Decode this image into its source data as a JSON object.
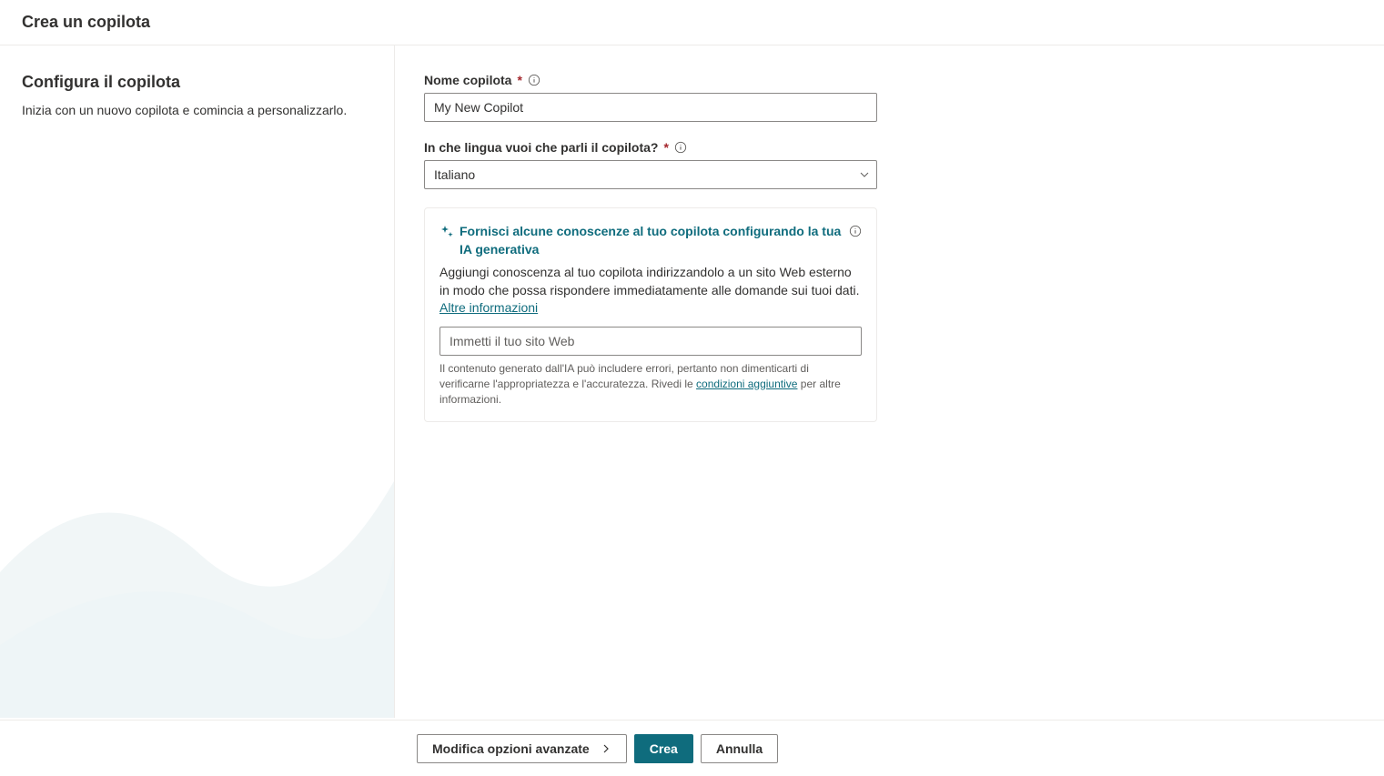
{
  "header": {
    "title": "Crea un copilota"
  },
  "sidebar": {
    "title": "Configura il copilota",
    "description": "Inizia con un nuovo copilota e comincia a personalizzarlo."
  },
  "form": {
    "name_label": "Nome copilota",
    "name_value": "My New Copilot",
    "lang_label": "In che lingua vuoi che parli il copilota?",
    "lang_value": "Italiano"
  },
  "ai_box": {
    "title": "Fornisci alcune conoscenze al tuo copilota configurando la tua IA generativa",
    "description_pre": "Aggiungi conoscenza al tuo copilota indirizzandolo a un sito Web esterno in modo che possa rispondere immediatamente alle domande sui tuoi dati. ",
    "more_link": "Altre informazioni",
    "url_placeholder": "Immetti il tuo sito Web",
    "disclaimer_pre": "Il contenuto generato dall'IA può includere errori, pertanto non dimenticarti di verificarne l'appropriatezza e l'accuratezza. Rivedi le ",
    "terms_link": "condizioni aggiuntive",
    "disclaimer_post": " per altre informazioni."
  },
  "footer": {
    "advanced": "Modifica opzioni avanzate",
    "create": "Crea",
    "cancel": "Annulla"
  }
}
